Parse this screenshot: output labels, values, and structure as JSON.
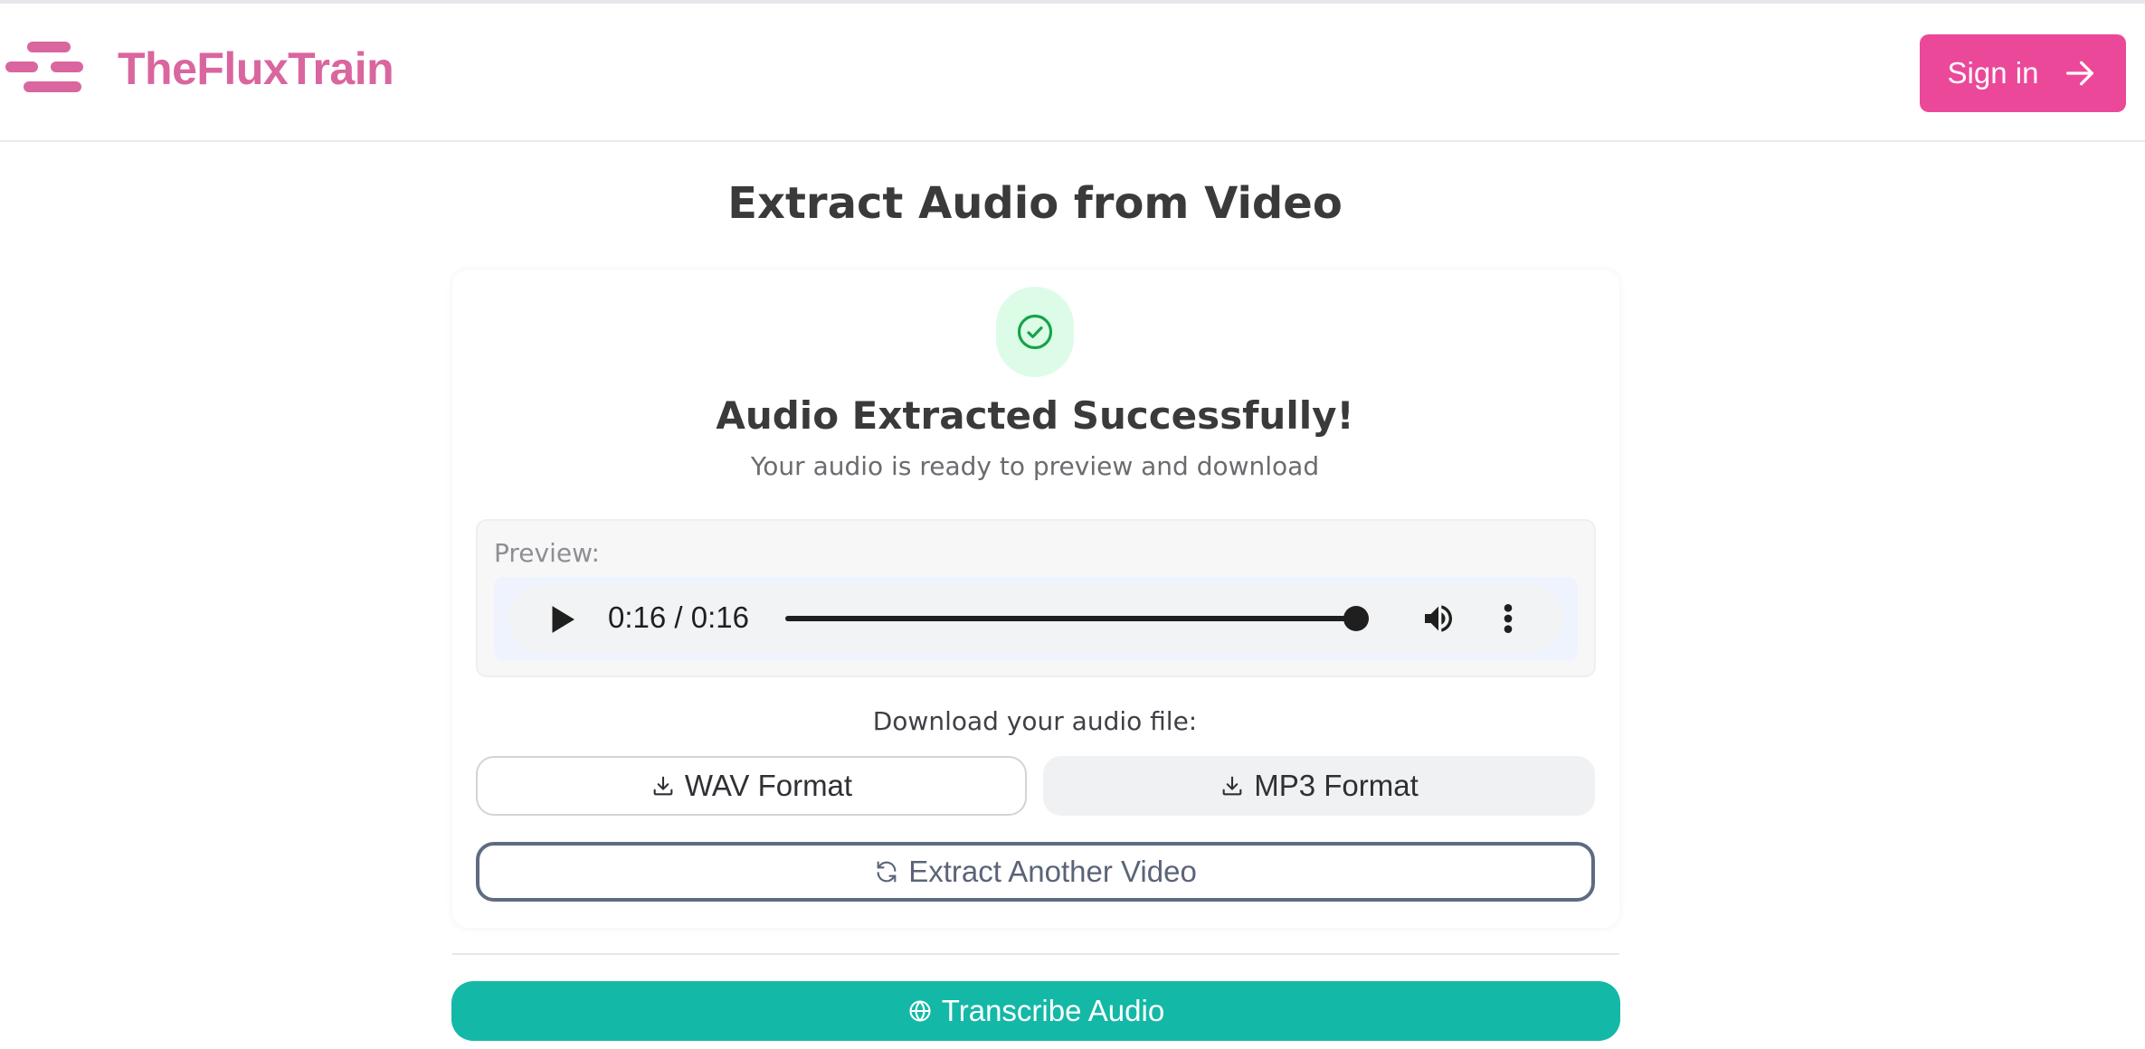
{
  "header": {
    "brand": "TheFluxTrain",
    "sign_in_label": "Sign in",
    "logo_icon": "menu-lines-logo-icon",
    "sign_in_icon": "arrow-right-icon"
  },
  "page": {
    "title": "Extract Audio from Video"
  },
  "result": {
    "icon": "check-circle-icon",
    "title": "Audio Extracted Successfully!",
    "subtitle": "Your audio is ready to preview and download"
  },
  "preview": {
    "label": "Preview:",
    "player": {
      "time": "0:16 / 0:16",
      "progress_fraction": 1.0
    }
  },
  "download": {
    "label": "Download your audio file:",
    "wav_label": "WAV Format",
    "mp3_label": "MP3 Format",
    "icon": "download-icon"
  },
  "actions": {
    "extract_another_label": "Extract Another Video",
    "extract_another_icon": "refresh-icon",
    "transcribe_label": "Transcribe Audio",
    "transcribe_icon": "globe-icon"
  },
  "colors": {
    "brand": "#d9669f",
    "sign_in_bg": "#ec4899",
    "success_bg": "#dcfce7",
    "success_icon": "#16a34a",
    "transcribe_bg": "#14b8a6"
  }
}
